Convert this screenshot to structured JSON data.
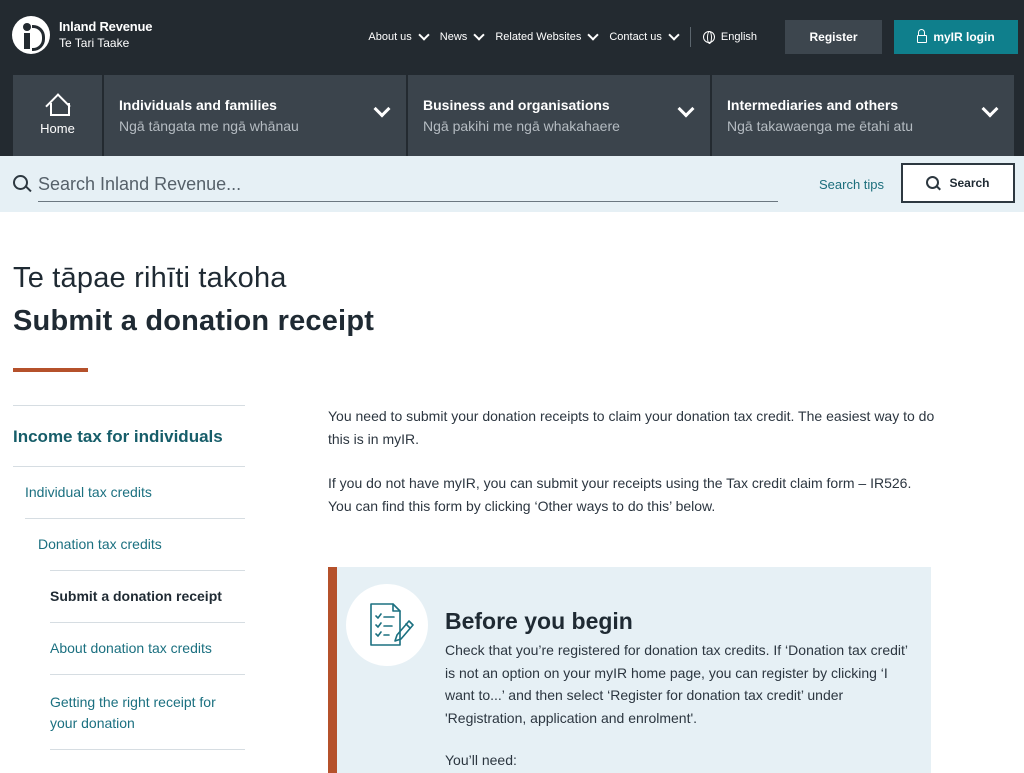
{
  "header": {
    "logo_line1": "Inland Revenue",
    "logo_line2": "Te Tari Taake",
    "utility_links": [
      {
        "label": "About us"
      },
      {
        "label": "News"
      },
      {
        "label": "Related Websites"
      },
      {
        "label": "Contact us"
      }
    ],
    "language": "English",
    "register_label": "Register",
    "login_label": "myIR login"
  },
  "nav": {
    "home_label": "Home",
    "sections": [
      {
        "title": "Individuals and families",
        "subtitle": "Ngā tāngata me ngā whānau"
      },
      {
        "title": "Business and organisations",
        "subtitle": "Ngā pakihi me ngā whakahaere"
      },
      {
        "title": "Intermediaries and others",
        "subtitle": "Ngā takawaenga me ētahi atu"
      }
    ]
  },
  "search": {
    "placeholder": "Search Inland Revenue...",
    "tips_label": "Search tips",
    "button_label": "Search"
  },
  "page": {
    "title_maori": "Te tāpae rihīti takoha",
    "title_en": "Submit a donation receipt"
  },
  "sidenav": {
    "top": "Income tax for individuals",
    "level1": "Individual tax credits",
    "level2": "Donation tax credits",
    "level3": [
      {
        "label": "Submit a donation receipt"
      },
      {
        "label": "About donation tax credits"
      },
      {
        "label": "Getting the right receipt for your donation"
      }
    ]
  },
  "content": {
    "paragraph1": "You need to submit your donation receipts to claim your donation tax credit. The easiest way to do this is in myIR.",
    "paragraph2": "If you do not have myIR, you can submit your receipts using the Tax credit claim form – IR526. You can find this form by clicking ‘Other ways to do this’ below.",
    "callout": {
      "heading": "Before you begin",
      "text": "Check that you’re registered for donation tax credits. If ‘Donation tax credit’ is not an option on your myIR home page, you can register by clicking ‘I want to...’ and then select ‘Register for donation tax credit’ under 'Registration, application and enrolment'.",
      "need": "You’ll need:"
    }
  },
  "colors": {
    "header_bg": "#232a30",
    "accent_teal": "#0f7f8c",
    "accent_rust": "#b5512b",
    "search_band": "#e6f0f5"
  }
}
